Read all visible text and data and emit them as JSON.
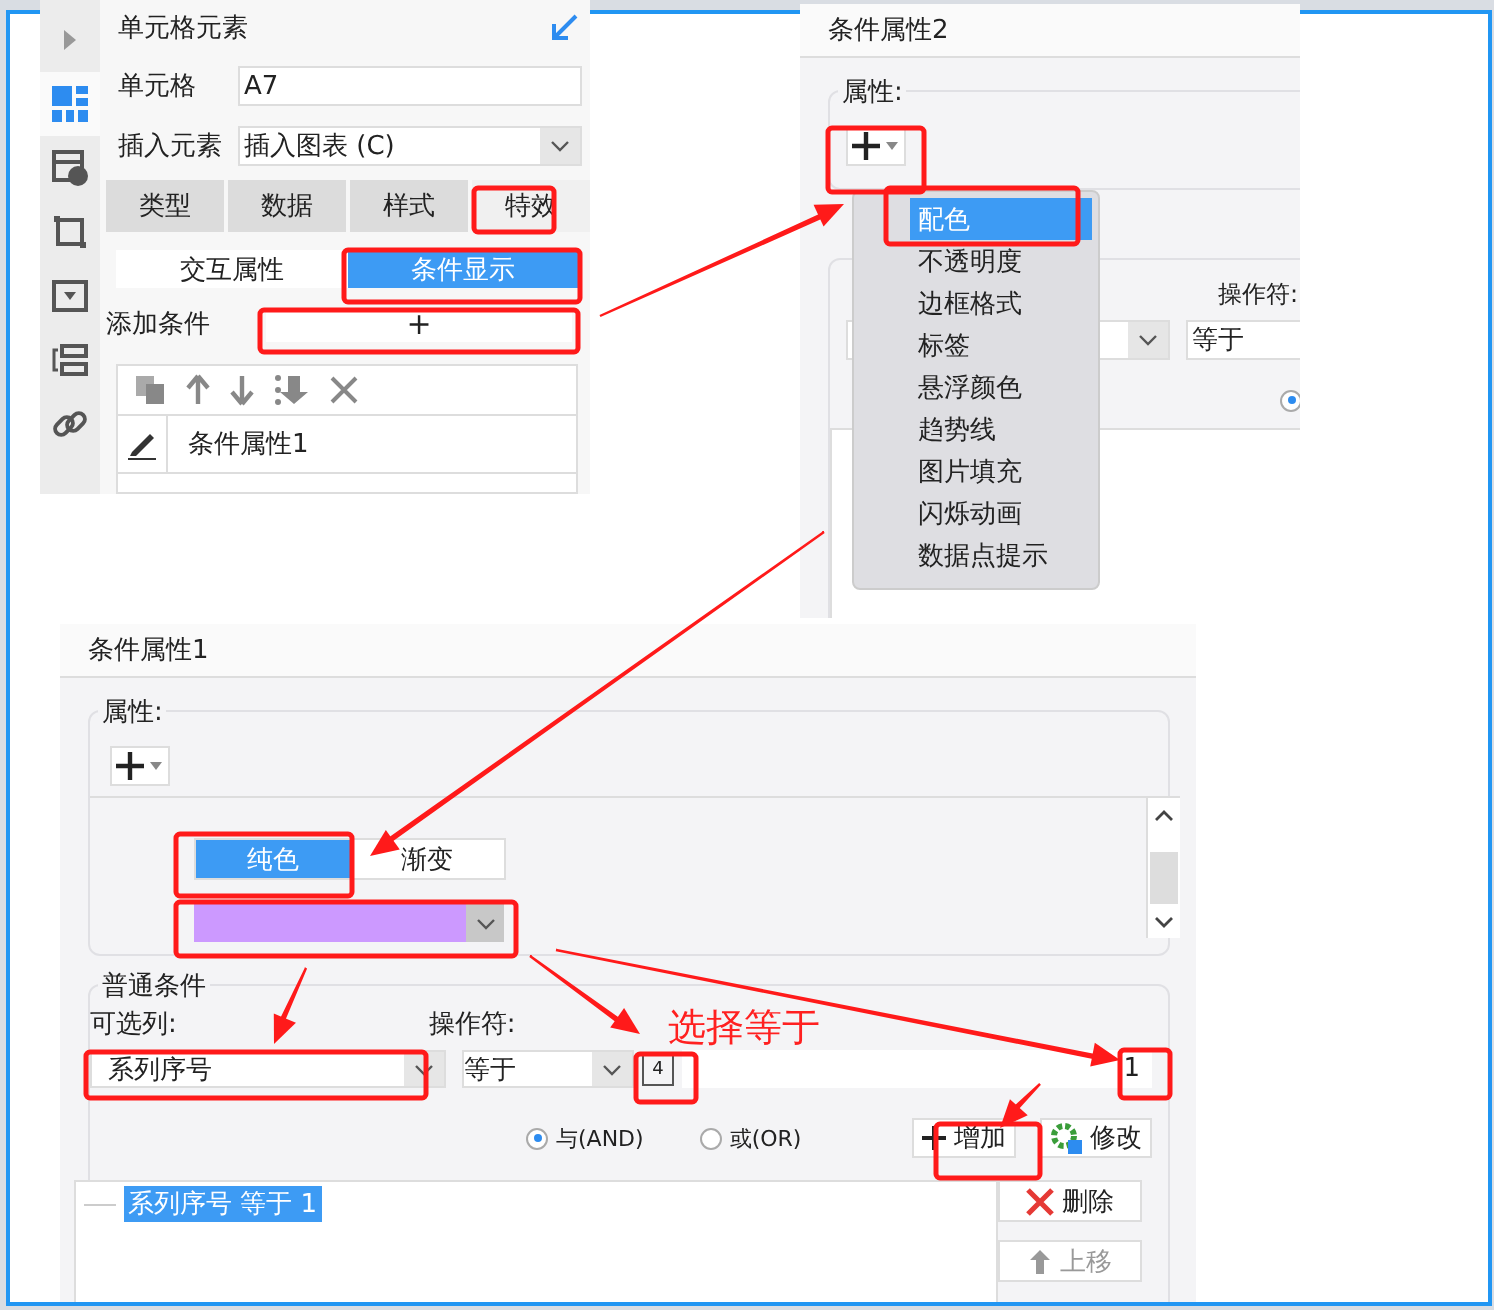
{
  "cell_panel": {
    "title": "单元格元素",
    "fields": [
      {
        "label": "单元格",
        "value": "A7",
        "kind": "text"
      },
      {
        "label": "插入元素",
        "value": "插入图表 (C)",
        "kind": "select"
      }
    ],
    "tabs": [
      {
        "label": "类型",
        "selected": false
      },
      {
        "label": "数据",
        "selected": false
      },
      {
        "label": "样式",
        "selected": false
      },
      {
        "label": "特效",
        "selected": true
      }
    ],
    "subtabs": [
      {
        "label": "交互属性",
        "selected": false
      },
      {
        "label": "条件显示",
        "selected": true
      }
    ],
    "add_label": "添加条件",
    "add_button": "+",
    "conditions": [
      {
        "label": "条件属性1"
      }
    ]
  },
  "condition_panel_2": {
    "title": "条件属性2",
    "attr_label": "属性:",
    "operator_label": "操作符:",
    "operator_value": "等于",
    "radio": {
      "selected": true
    },
    "menu": [
      {
        "label": "配色",
        "selected": true
      },
      {
        "label": "不透明度",
        "selected": false
      },
      {
        "label": "边框格式",
        "selected": false
      },
      {
        "label": "标签",
        "selected": false
      },
      {
        "label": "悬浮颜色",
        "selected": false
      },
      {
        "label": "趋势线",
        "selected": false
      },
      {
        "label": "图片填充",
        "selected": false
      },
      {
        "label": "闪烁动画",
        "selected": false
      },
      {
        "label": "数据点提示",
        "selected": false
      }
    ]
  },
  "condition_panel_1": {
    "title": "条件属性1",
    "attr_label": "属性:",
    "fill_modes": [
      {
        "label": "纯色",
        "selected": true
      },
      {
        "label": "渐变",
        "selected": false
      }
    ],
    "color": "#cc99ff",
    "section_label": "普通条件",
    "column_label": "可选列:",
    "column_value": "系列序号",
    "operator_label": "操作符:",
    "operator_value": "等于",
    "param_icon": "4",
    "value": "1",
    "logic": [
      {
        "label": "与(AND)",
        "selected": true
      },
      {
        "label": "或(OR)",
        "selected": false
      }
    ],
    "add_button": "增加",
    "edit_button": "修改",
    "rules": [
      {
        "label": "系列序号 等于 1",
        "selected": true
      }
    ],
    "side_buttons": [
      {
        "label": "删除",
        "disabled": false,
        "kind": "delete"
      },
      {
        "label": "上移",
        "disabled": true,
        "kind": "up"
      }
    ]
  },
  "annotation": {
    "note": "选择等于"
  }
}
